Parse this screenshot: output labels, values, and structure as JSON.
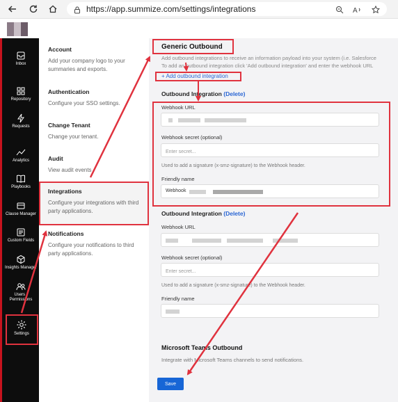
{
  "browser": {
    "url": "https://app.summize.com/settings/integrations"
  },
  "sidebar": {
    "items": [
      {
        "label": "Inbox",
        "icon": "inbox-icon"
      },
      {
        "label": "Repository",
        "icon": "grid-icon"
      },
      {
        "label": "Requests",
        "icon": "lightning-icon"
      },
      {
        "label": "Analytics",
        "icon": "line-chart-icon"
      },
      {
        "label": "Playbooks",
        "icon": "book-icon"
      },
      {
        "label": "Clause Manager",
        "icon": "clause-icon"
      },
      {
        "label": "Custom Fields",
        "icon": "custom-fields-icon"
      },
      {
        "label": "Insights Manager",
        "icon": "cube-icon"
      },
      {
        "label": "Users / Permissions",
        "icon": "users-icon"
      },
      {
        "label": "Settings",
        "icon": "gear-icon"
      }
    ]
  },
  "settings_nav": {
    "account": {
      "title": "Account",
      "desc": "Add your company logo to your summaries and exports."
    },
    "authentication": {
      "title": "Authentication",
      "desc": "Configure your SSO settings."
    },
    "change_tenant": {
      "title": "Change Tenant",
      "desc": "Change your tenant."
    },
    "audit": {
      "title": "Audit",
      "desc": "View audit events"
    },
    "integrations": {
      "title": "Integrations",
      "desc": "Configure your integrations with third party applications."
    },
    "notifications": {
      "title": "Notifications",
      "desc": "Configure your notifications to third party applications."
    }
  },
  "main": {
    "generic_title": "Generic Outbound",
    "intro_line1": "Add outbound integrations to receive an information payload into your system (i.e. Salesforce",
    "intro_line2": "To add an outbound integration click 'Add outbound integration' and enter the webhook URL",
    "add_link": "+ Add outbound integration",
    "integration1": {
      "title": "Outbound Integration",
      "delete": "(Delete)",
      "webhook_url_label": "Webhook URL",
      "secret_label": "Webhook secret (optional)",
      "secret_placeholder": "Enter secret...",
      "secret_hint": "Used to add a signature (x-smz-signature) to the Webhook header.",
      "friendly_name_label": "Friendly name",
      "friendly_name_value": "Webhook"
    },
    "integration2": {
      "title": "Outbound Integration",
      "delete": "(Delete)",
      "webhook_url_label": "Webhook URL",
      "secret_label": "Webhook secret (optional)",
      "secret_placeholder": "Enter secret...",
      "secret_hint": "Used to add a signature (x-smz-signature) to the Webhook header.",
      "friendly_name_label": "Friendly name"
    },
    "teams_title": "Microsoft Teams Outbound",
    "teams_desc": "Integrate with Microsoft Teams channels to send notifications.",
    "save_label": "Save"
  },
  "colors": {
    "annotation": "#e0323e",
    "accent": "#1766d6",
    "link": "#2a66d4",
    "sidebar_bg": "#0d0d0d"
  }
}
